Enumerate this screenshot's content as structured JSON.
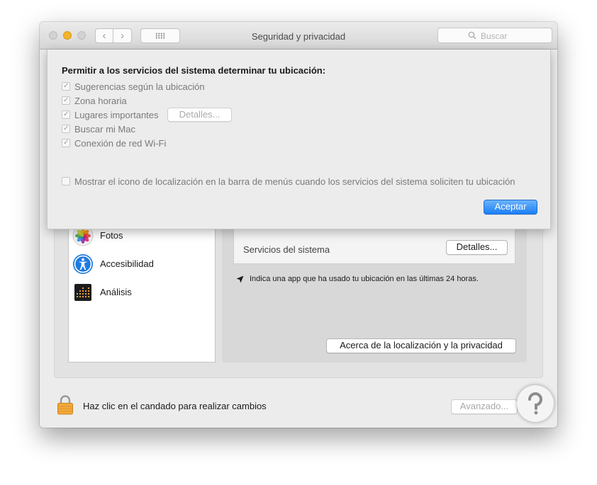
{
  "window": {
    "title": "Seguridad y privacidad",
    "search_placeholder": "Buscar",
    "back_glyph": "‹",
    "forward_glyph": "›"
  },
  "sheet": {
    "heading": "Permitir a los servicios del sistema determinar tu ubicación:",
    "options": [
      {
        "label": "Sugerencias según la ubicación",
        "checked": true
      },
      {
        "label": "Zona horaria",
        "checked": true
      },
      {
        "label": "Lugares importantes",
        "checked": true
      },
      {
        "label": "Buscar mi Mac",
        "checked": true
      },
      {
        "label": "Conexión de red Wi-Fi",
        "checked": true
      }
    ],
    "details_button": "Detalles...",
    "menu_icon_option": {
      "label": "Mostrar el icono de localización en la barra de menús cuando los servicios del sistema soliciten tu ubicación",
      "checked": false
    },
    "accept_button": "Aceptar"
  },
  "app_list": {
    "items": [
      {
        "label": "Fotos",
        "icon": "photos-icon"
      },
      {
        "label": "Accesibilidad",
        "icon": "accessibility-icon"
      },
      {
        "label": "Análisis",
        "icon": "analytics-icon"
      }
    ]
  },
  "right_pane": {
    "system_services_label": "Servicios del sistema",
    "details_button": "Detalles...",
    "note": "Indica una app que ha usado tu ubicación en las últimas 24 horas.",
    "about_button": "Acerca de la localización y la privacidad"
  },
  "footer": {
    "lock_text": "Haz clic en el candado para realizar cambios",
    "advanced_button": "Avanzado..."
  },
  "colors": {
    "accent": "#1b7ff6",
    "lock": "#f2a93b",
    "minimize": "#f5b329"
  }
}
